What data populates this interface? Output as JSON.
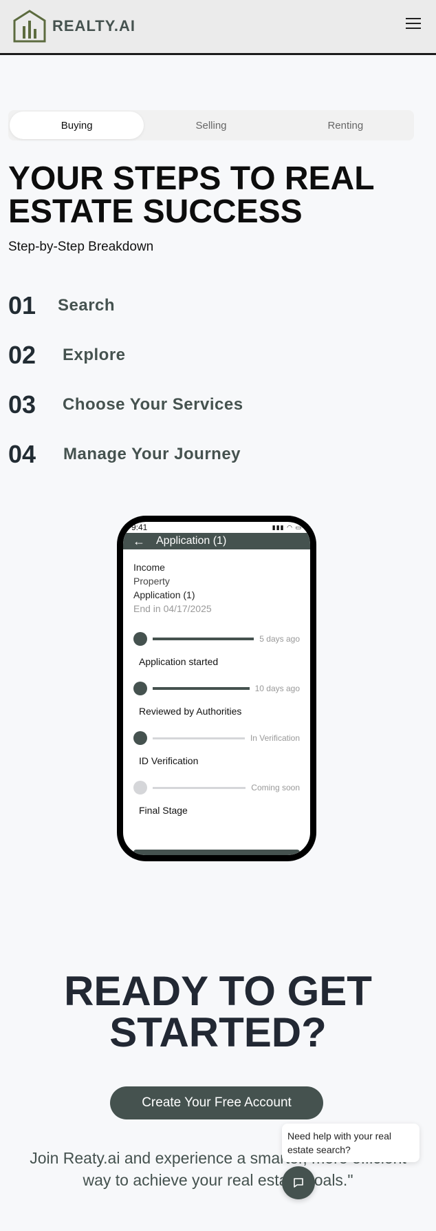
{
  "header": {
    "brand": "REALTY.AI",
    "logo_icon": "house-chart-icon",
    "menu_icon": "hamburger-menu-icon"
  },
  "tabs": [
    {
      "label": "Buying",
      "active": true
    },
    {
      "label": "Selling",
      "active": false
    },
    {
      "label": "Renting",
      "active": false
    }
  ],
  "hero": {
    "title": "YOUR STEPS TO REAL ESTATE SUCCESS",
    "subtitle": "Step-by-Step Breakdown"
  },
  "steps": [
    {
      "num": "01",
      "label": "Search"
    },
    {
      "num": "02",
      "label": "Explore"
    },
    {
      "num": "03",
      "label": "Choose Your Services"
    },
    {
      "num": "04",
      "label": "Manage Your Journey"
    }
  ],
  "phone": {
    "time": "9:41",
    "title": "Application (1)",
    "summary": {
      "income": "Income",
      "property": "Property",
      "application": "Application (1)",
      "end": "End in 04/17/2025"
    },
    "timeline": [
      {
        "label": "Application started",
        "meta": "5 days ago",
        "done": true
      },
      {
        "label": "Reviewed by Authorities",
        "meta": "10 days ago",
        "done": true
      },
      {
        "label": "ID Verification",
        "meta": "In Verification",
        "done": true
      },
      {
        "label": "Final Stage",
        "meta": "Coming soon",
        "done": false
      }
    ]
  },
  "cta": {
    "title": "READY TO GET STARTED?",
    "button": "Create Your Free Account",
    "subtitle": "Join Reaty.ai and experience a smarter, more efficient way to achieve your real estate goals.\""
  },
  "chat": {
    "message": "Need help with your real estate search?",
    "icon": "chat-icon"
  },
  "colors": {
    "accent": "#45524f",
    "heading": "#222833",
    "background": "#f7f8fa"
  }
}
